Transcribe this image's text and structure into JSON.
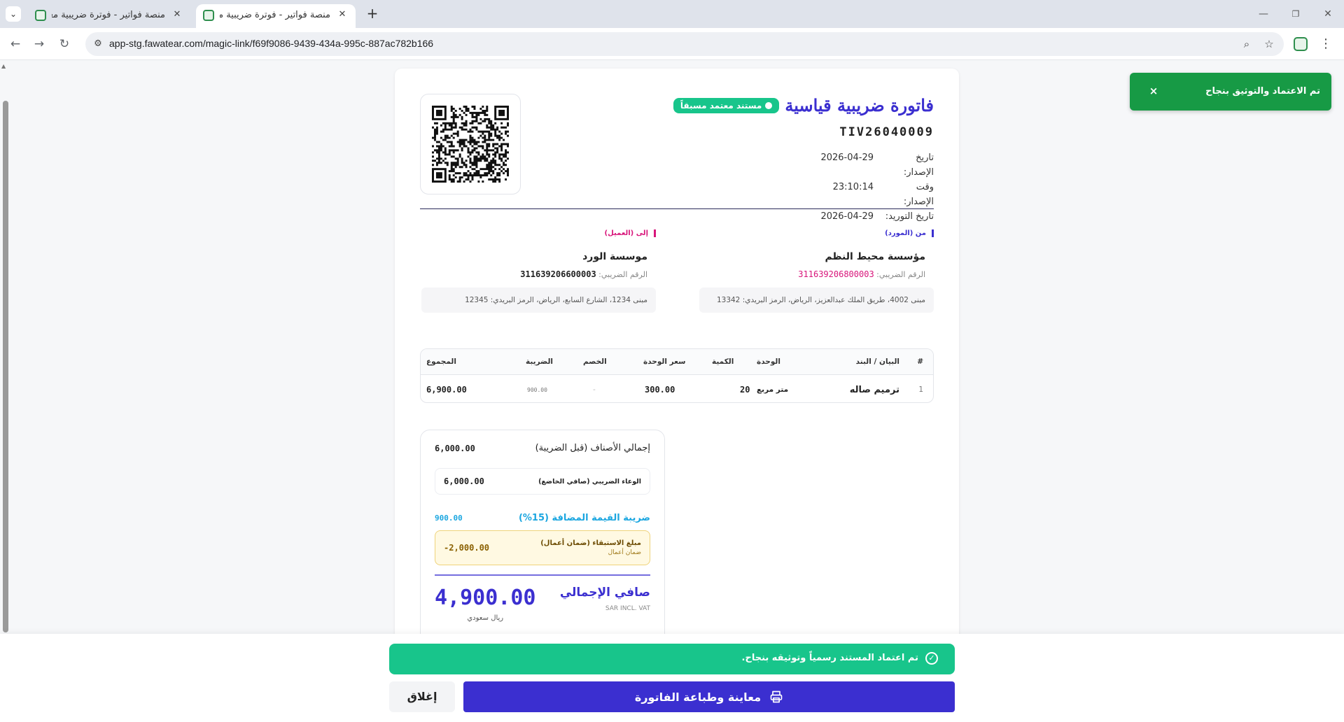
{
  "browser": {
    "tabs": [
      {
        "title": "منصة فواتير - فوترة ضريبية معتمدة",
        "active": false
      },
      {
        "title": "منصة فواتير - فوترة ضريبية معتمدة",
        "active": true
      }
    ],
    "url": "app-stg.fawatear.com/magic-link/f69f9086-9439-434a-995c-887ac782b166"
  },
  "invoice": {
    "badge": "مستند معتمد مسبقاً",
    "title": "فاتورة ضريبية قياسية",
    "number": "TIV26040009",
    "meta": [
      {
        "label": "تاريخ الإصدار:",
        "value": "2026-04-29"
      },
      {
        "label": "وقت الإصدار:",
        "value": "23:10:14"
      },
      {
        "label": "تاريخ التوريد:",
        "value": "2026-04-29"
      }
    ],
    "seller": {
      "tag": "من (المورد)",
      "name": "مؤسسة محيط النظم",
      "tax_label": "الرقم الضريبي:",
      "tax_number": "311639206800003",
      "address": "مبنى 4002، طريق الملك عبدالعزيز، الرياض، الرمز البريدي: 13342"
    },
    "buyer": {
      "tag": "إلى (العميل)",
      "name": "موسسة الورد",
      "tax_label": "الرقم الضريبي:",
      "tax_number": "311639206600003",
      "address": "مبنى 1234، الشارع السابع، الرياض، الرمز البريدي: 12345"
    },
    "items_header": {
      "num": "#",
      "desc": "البيان / البند",
      "unit": "الوحدة",
      "qty": "الكمية",
      "price": "سعر الوحدة",
      "discount": "الخصم",
      "tax": "الضريبة",
      "total": "المجموع"
    },
    "items": [
      {
        "num": "1",
        "desc": "ترميم صاله",
        "unit": "متر مربع",
        "qty": "20",
        "price": "300.00",
        "discount": "-",
        "tax": "900.00",
        "total": "6,900.00"
      }
    ],
    "totals": {
      "subtotal_label": "إجمالي الأصناف (قبل الضريبة)",
      "subtotal": "6,000.00",
      "taxable_label": "الوعاء الضريبي (صافي الخاضع)",
      "taxable": "6,000.00",
      "vat_label": "ضريبة القيمة المضافة (15%)",
      "vat": "900.00",
      "retention_label": "مبلغ الاستبقاء (ضمان أعمال)",
      "retention_sub": "ضمان أعمال",
      "retention": "-2,000.00",
      "net_label": "صافي الإجمالي",
      "net_sub": "SAR INCL. VAT",
      "net": "4,900.00",
      "currency": "ريال سعودي"
    }
  },
  "toast": {
    "message": "تم الاعتماد والتوثيق بنجاح",
    "close": "×"
  },
  "footer": {
    "success_message": "تم اعتماد المستند رسمياً وتوثيقه بنجاح.",
    "print_label": "معاينة وطباعة الفاتورة",
    "close_label": "إغلاق"
  },
  "colors": {
    "primary": "#3b2fd0",
    "success": "#18c58b",
    "toast": "#179a45",
    "accent_pink": "#d8157a",
    "vat_blue": "#1aa6e0"
  }
}
